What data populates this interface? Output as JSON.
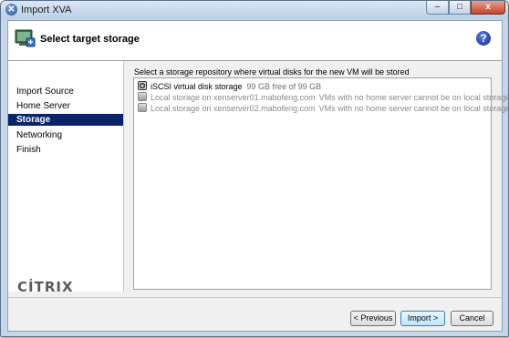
{
  "window": {
    "title": "Import XVA",
    "min_label": "–",
    "max_label": "□",
    "close_label": "x"
  },
  "header": {
    "title": "Select target storage",
    "help_label": "?"
  },
  "sidebar": {
    "items": [
      {
        "label": "Import Source",
        "active": false
      },
      {
        "label": "Home Server",
        "active": false
      },
      {
        "label": "Storage",
        "active": true
      },
      {
        "label": "Networking",
        "active": false
      },
      {
        "label": "Finish",
        "active": false
      }
    ],
    "logo_text": "CİTRIX"
  },
  "content": {
    "instruction": "Select a storage repository where virtual disks for the new VM will be stored",
    "storage_repositories": [
      {
        "name": "iSCSI virtual disk storage",
        "free": "99 GB free of 99 GB",
        "reason": "",
        "enabled": true,
        "selected": true
      },
      {
        "name": "Local storage on xenserver01.mabofeng.com",
        "free": "",
        "reason": "VMs with no home server cannot be on local storage",
        "enabled": false,
        "selected": false
      },
      {
        "name": "Local storage on xenserver02.mabofeng.com",
        "free": "",
        "reason": "VMs with no home server cannot be on local storage",
        "enabled": false,
        "selected": false
      }
    ]
  },
  "buttons": {
    "previous": "< Previous",
    "import": "Import >",
    "cancel": "Cancel"
  },
  "colors": {
    "active_nav": "#0a246a",
    "title_bar": "#c5d6ea"
  }
}
